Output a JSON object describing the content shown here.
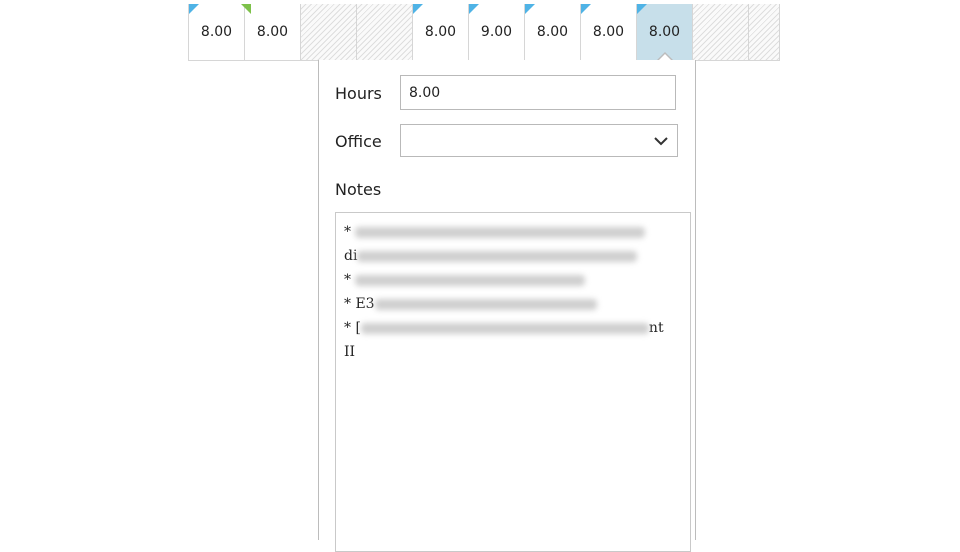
{
  "grid": {
    "cells": [
      {
        "value": "8.00",
        "state": "filled"
      },
      {
        "value": "8.00",
        "state": "filled"
      },
      {
        "value": "",
        "state": "empty"
      },
      {
        "value": "",
        "state": "empty"
      },
      {
        "value": "8.00",
        "state": "filled"
      },
      {
        "value": "9.00",
        "state": "filled"
      },
      {
        "value": "8.00",
        "state": "filled"
      },
      {
        "value": "8.00",
        "state": "filled"
      },
      {
        "value": "8.00",
        "state": "selected"
      },
      {
        "value": "",
        "state": "empty"
      },
      {
        "value": "",
        "state": "empty"
      }
    ]
  },
  "popup": {
    "hours_label": "Hours",
    "hours_value": "8.00",
    "office_label": "Office",
    "office_value": "",
    "notes_label": "Notes",
    "notes_lines": [
      "* ",
      "di",
      "* ",
      "* E3",
      "* [",
      "II"
    ],
    "notes_line_end": "nt"
  },
  "colors": {
    "selected_cell": "#c7dfea",
    "flag_blue": "#4fb3e6",
    "flag_green": "#7dc14a"
  }
}
